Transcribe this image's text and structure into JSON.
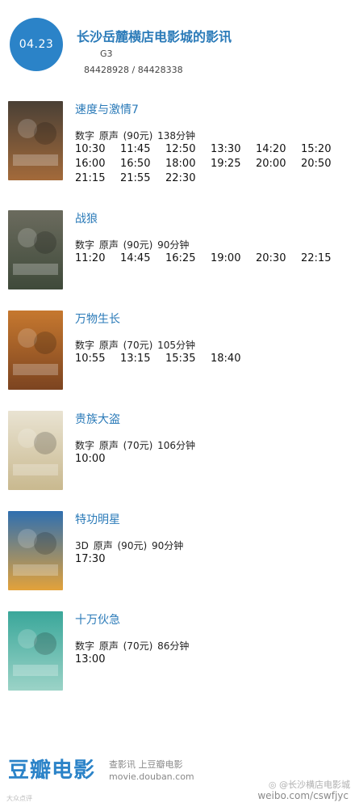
{
  "header": {
    "date": "04.23",
    "cinema_name": "长沙岳麓横店电影城的影讯",
    "hall": "G3",
    "phone": "84428928 / 84428338"
  },
  "movies": [
    {
      "title": "速度与激情7",
      "meta": "数字 原声 (90元) 138分钟",
      "times": [
        "10:30",
        "11:45",
        "12:50",
        "13:30",
        "14:20",
        "15:20",
        "16:00",
        "16:50",
        "18:00",
        "19:25",
        "20:00",
        "20:50",
        "21:15",
        "21:55",
        "22:30"
      ],
      "poster_colors": [
        "#4a4036",
        "#a36a3a"
      ],
      "poster_text": "速度与激情7"
    },
    {
      "title": "战狼",
      "meta": "数字 原声 (90元) 90分钟",
      "times": [
        "11:20",
        "14:45",
        "16:25",
        "19:00",
        "20:30",
        "22:15"
      ],
      "poster_colors": [
        "#6b6b5e",
        "#3f4a3a"
      ],
      "poster_text": "战狼"
    },
    {
      "title": "万物生长",
      "meta": "数字 原声 (70元) 105分钟",
      "times": [
        "10:55",
        "13:15",
        "15:35",
        "18:40"
      ],
      "poster_colors": [
        "#c6782f",
        "#7c4420"
      ],
      "poster_text": "万物生长"
    },
    {
      "title": "贵族大盗",
      "meta": "数字 原声 (70元) 106分钟",
      "times": [
        "10:00"
      ],
      "poster_colors": [
        "#e9e3d2",
        "#c9b98f"
      ],
      "poster_text": "贵族大盗"
    },
    {
      "title": "特功明星",
      "meta": "3D 原声 (90元) 90分钟",
      "times": [
        "17:30"
      ],
      "poster_colors": [
        "#2f6fb0",
        "#e3a23a"
      ],
      "poster_text": "特功明星"
    },
    {
      "title": "十万伙急",
      "meta": "数字 原声 (70元) 86分钟",
      "times": [
        "13:00"
      ],
      "poster_colors": [
        "#3aa79a",
        "#9bd3c7"
      ],
      "poster_text": "十万伙急"
    }
  ],
  "footer": {
    "logo": "豆瓣电影",
    "slogan": "查影讯 上豆瓣电影",
    "url": "movie.douban.com"
  },
  "watermarks": {
    "left": "大众点评",
    "right_top": "@长沙横店电影城",
    "right_bottom": "weibo.com/cswfjyc"
  },
  "colors": {
    "accent": "#2b83c8",
    "title": "#2a7ab8"
  }
}
